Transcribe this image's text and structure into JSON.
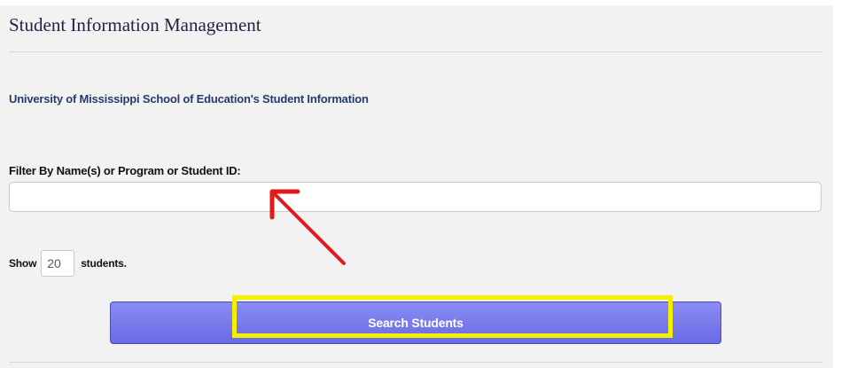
{
  "header": {
    "title": "Student Information Management"
  },
  "main": {
    "subtitle": "University of Mississippi School of Education's Student Information",
    "filter": {
      "label": "Filter By Name(s) or Program or Student ID:",
      "value": "",
      "placeholder": ""
    },
    "show": {
      "prefix": "Show",
      "count": "20",
      "suffix": "students."
    },
    "search_button_label": "Search Students"
  },
  "annotations": {
    "arrow_color": "#e41a1a",
    "highlight_color": "#f3f000",
    "arrow_icon": "arrow-pointing-up-left-icon"
  },
  "colors": {
    "button_gradient_top": "#8b8bf2",
    "button_gradient_bottom": "#6a6ae6",
    "subtitle_text": "#283a6b",
    "panel_background": "#f2f2f2"
  }
}
